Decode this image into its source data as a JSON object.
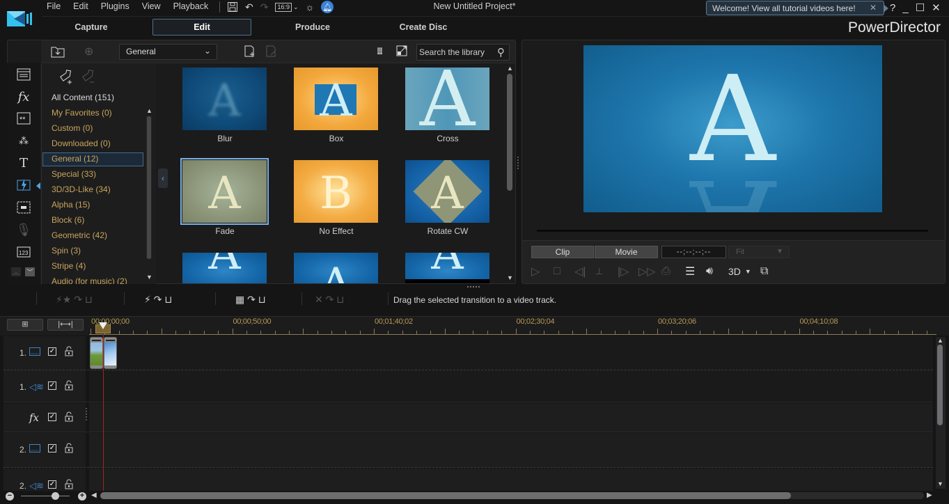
{
  "app": {
    "title": "New Untitled Project*",
    "brand": "PowerDirector",
    "menu": [
      "File",
      "Edit",
      "Plugins",
      "View",
      "Playback"
    ],
    "aspect_ratio": "16:9",
    "welcome_tip": "Welcome! View all tutorial videos here!",
    "help_label": "?"
  },
  "modes": [
    {
      "label": "Capture",
      "active": false
    },
    {
      "label": "Edit",
      "active": true
    },
    {
      "label": "Produce",
      "active": false
    },
    {
      "label": "Create Disc",
      "active": false
    }
  ],
  "library": {
    "dropdown_value": "General",
    "search_placeholder": "Search the library",
    "categories": [
      {
        "label": "All Content (151)",
        "kind": "all"
      },
      {
        "label": "My Favorites  (0)"
      },
      {
        "label": "Custom  (0)"
      },
      {
        "label": "Downloaded  (0)"
      },
      {
        "label": "General  (12)",
        "selected": true
      },
      {
        "label": "Special  (33)"
      },
      {
        "label": "3D/3D-Like  (34)"
      },
      {
        "label": "Alpha  (15)"
      },
      {
        "label": "Block  (6)"
      },
      {
        "label": "Geometric  (42)"
      },
      {
        "label": "Spin  (3)"
      },
      {
        "label": "Stripe  (4)"
      },
      {
        "label": "Audio (for music)  (2)"
      }
    ],
    "transitions": [
      {
        "label": "Blur"
      },
      {
        "label": "Box"
      },
      {
        "label": "Cross"
      },
      {
        "label": "Fade",
        "selected": true
      },
      {
        "label": "No Effect"
      },
      {
        "label": "Rotate CW"
      }
    ],
    "rail_icons": [
      "media-room-icon",
      "fx-icon",
      "pip-objects-icon",
      "particle-icon",
      "title-icon",
      "transition-icon",
      "subtitle-icon",
      "voice-over-icon",
      "chapter-icon"
    ]
  },
  "preview": {
    "letter": "A",
    "clip_label": "Clip",
    "movie_label": "Movie",
    "timecode": "--;--;--;--",
    "fit_label": "Fit",
    "threed_label": "3D"
  },
  "edit_toolbar": {
    "hint": "Drag the selected transition to a video track."
  },
  "timeline": {
    "ruler_labels": [
      "00;00;00;00",
      "00;00;50;00",
      "00;01;40;02",
      "00;02;30;04",
      "00;03;20;06",
      "00;04;10;08"
    ],
    "tracks": [
      {
        "num": "1.",
        "type": "video"
      },
      {
        "num": "1.",
        "type": "audio"
      },
      {
        "num": "",
        "type": "fx",
        "label": "fx"
      },
      {
        "num": "2.",
        "type": "video"
      },
      {
        "num": "2.",
        "type": "audio"
      }
    ],
    "check_mark": "✓"
  }
}
